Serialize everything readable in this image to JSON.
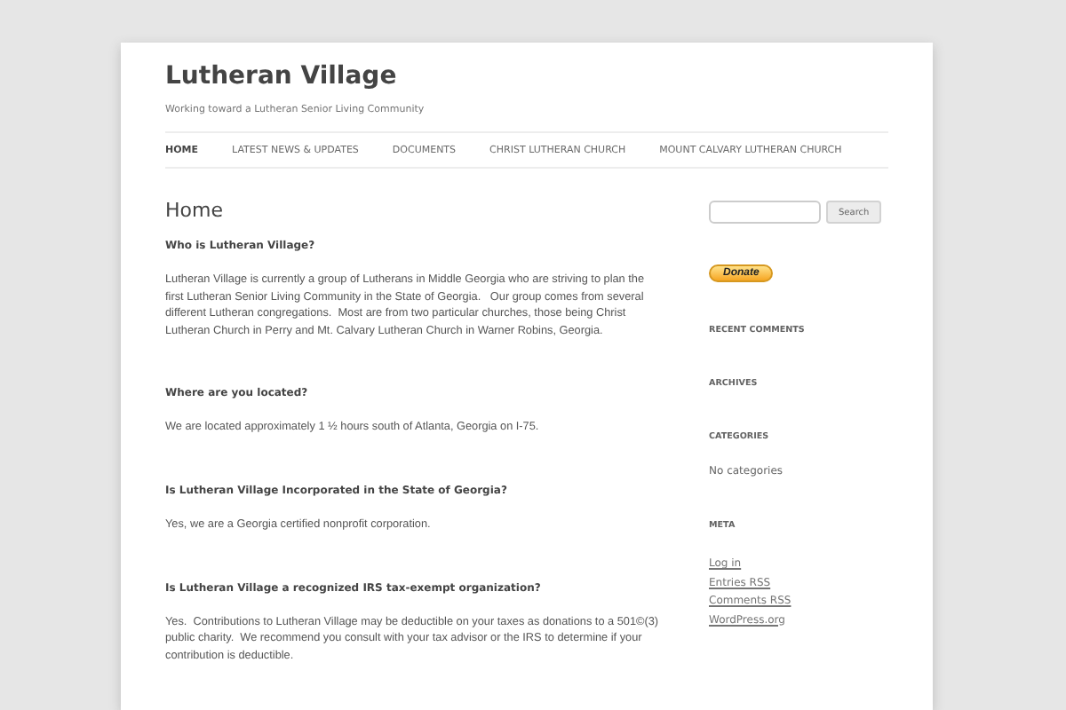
{
  "site": {
    "title": "Lutheran Village",
    "tagline": "Working toward a Lutheran Senior Living Community"
  },
  "nav": [
    {
      "label": "HOME",
      "selected": true
    },
    {
      "label": "LATEST NEWS & UPDATES",
      "selected": false
    },
    {
      "label": "DOCUMENTS",
      "selected": false
    },
    {
      "label": "CHRIST LUTHERAN CHURCH",
      "selected": false
    },
    {
      "label": "MOUNT CALVARY LUTHERAN CHURCH",
      "selected": false
    }
  ],
  "page": {
    "title": "Home",
    "sections": [
      {
        "question": "Who is Lutheran Village?",
        "answer": "Lutheran Village is currently a group of Lutherans in Middle Georgia who are striving to plan the first Lutheran Senior Living Community in the State of Georgia.   Our group comes from several different Lutheran congregations.  Most are from two particular churches, those being Christ Lutheran Church in Perry and Mt. Calvary Lutheran Church in Warner Robins, Georgia."
      },
      {
        "question": "Where are you located?",
        "answer": "We are located approximately 1 ½ hours south of Atlanta, Georgia on I-75."
      },
      {
        "question": "Is Lutheran Village Incorporated in the State of Georgia?",
        "answer": "Yes, we are a Georgia certified nonprofit corporation."
      },
      {
        "question": "Is Lutheran Village a recognized IRS tax-exempt organization?",
        "answer": "Yes.  Contributions to Lutheran Village may be deductible on your taxes as donations to a 501©(3) public charity.  We recommend you consult with your tax advisor or the IRS to determine if your contribution is deductible."
      }
    ]
  },
  "sidebar": {
    "search_button": "Search",
    "donate_button": "Donate",
    "widgets": [
      {
        "title": "RECENT COMMENTS"
      },
      {
        "title": "ARCHIVES"
      },
      {
        "title": "CATEGORIES",
        "text": "No categories"
      },
      {
        "title": "META",
        "links": [
          "Log in",
          "Entries RSS",
          "Comments RSS",
          "WordPress.org"
        ]
      }
    ]
  }
}
